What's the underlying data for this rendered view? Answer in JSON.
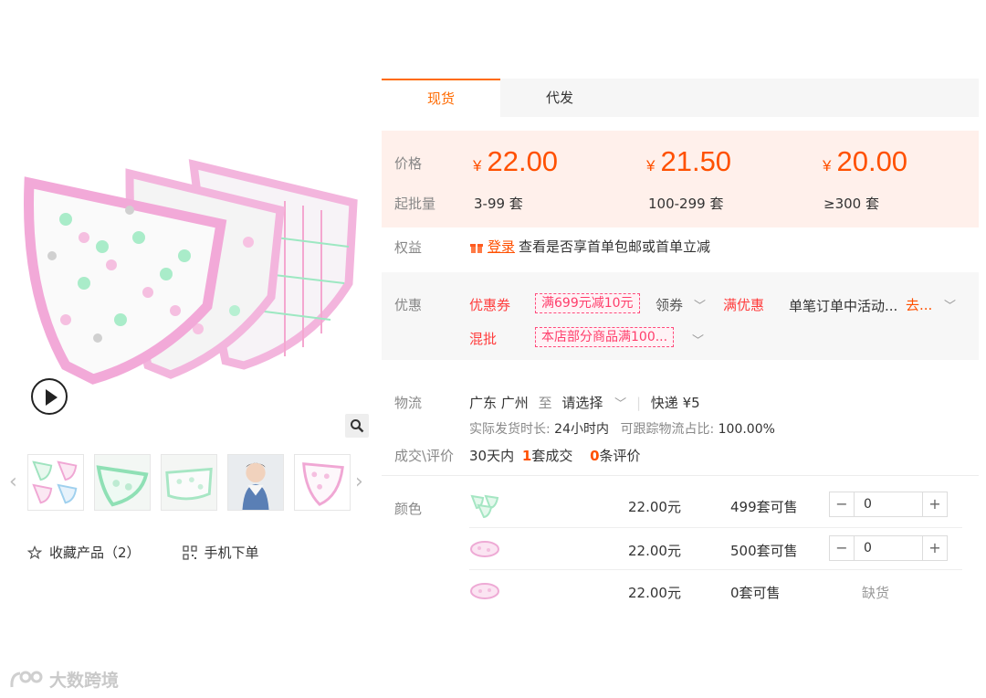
{
  "tabs": [
    {
      "label": "现货"
    },
    {
      "label": "代发"
    }
  ],
  "pricing": {
    "price_label": "价格",
    "qty_label": "起批量",
    "currency": "¥",
    "tiers": [
      {
        "price": "22.00",
        "qty": "3-99 套"
      },
      {
        "price": "21.50",
        "qty": "100-299 套"
      },
      {
        "price": "20.00",
        "qty": "≥300 套"
      }
    ]
  },
  "rights": {
    "label": "权益",
    "login": "登录",
    "text": "查看是否享首单包邮或首单立减"
  },
  "promos": {
    "label": "优惠",
    "coupon_name": "优惠券",
    "coupon_tag": "满699元减10元",
    "coupon_action": "领券",
    "full_name": "满优惠",
    "full_text": "单笔订单中活动...",
    "full_more": "去...",
    "mix_name": "混批",
    "mix_tag": "本店部分商品满100..."
  },
  "logistics": {
    "label": "物流",
    "from": "广东 广州",
    "to_word": "至",
    "select": "请选择",
    "express": "快递 ¥5",
    "ship_label": "实际发货时长:",
    "ship_value": "24小时内",
    "track_label": "可跟踪物流占比:",
    "track_value": "100.00%"
  },
  "deals": {
    "label": "成交\\评价",
    "days": "30天内",
    "sold_count": "1",
    "sold_unit": "套成交",
    "review_count": "0",
    "review_unit": "条评价"
  },
  "variants": {
    "label": "颜色",
    "rows": [
      {
        "price": "22.00元",
        "stock": "499套可售",
        "qty": "0",
        "status": ""
      },
      {
        "price": "22.00元",
        "stock": "500套可售",
        "qty": "0",
        "status": ""
      },
      {
        "price": "22.00元",
        "stock": "0套可售",
        "qty": "",
        "status": "缺货"
      }
    ]
  },
  "stepper": {
    "minus": "−",
    "plus": "+"
  },
  "gallery": {
    "prev": "‹",
    "next": "›"
  },
  "actions": {
    "favorite": "收藏产品（2）",
    "mobile": "手机下单"
  },
  "watermark": "大数跨境",
  "colors": {
    "accent": "#ff6a00",
    "price": "#ff5000",
    "promo_bg": "#fff0eb"
  }
}
